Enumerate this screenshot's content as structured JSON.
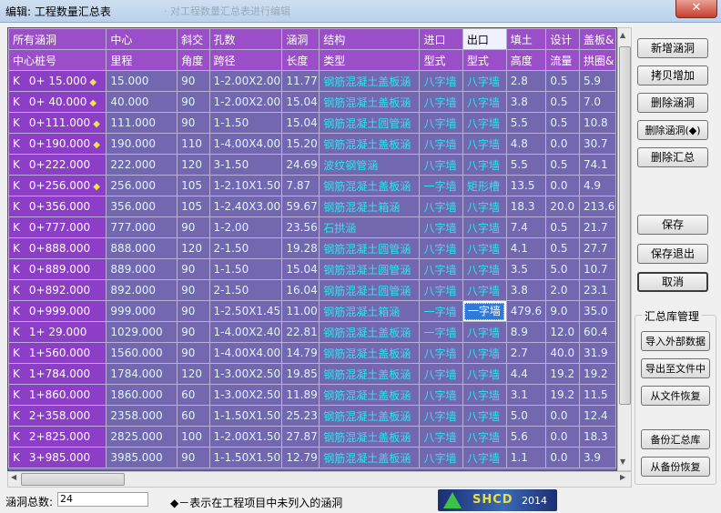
{
  "window": {
    "title": "编辑: 工程数量汇总表",
    "faded_title": "· 对工程数量汇总表进行编辑",
    "close_label": "✕"
  },
  "table": {
    "header1": [
      "所有涵洞",
      "中心",
      "斜交",
      "孔数",
      "涵洞",
      "结构",
      "进口",
      "出口",
      "填土",
      "设计",
      "盖板&"
    ],
    "header2": [
      "中心桩号",
      "里程",
      "角度",
      "跨径",
      "长度",
      "类型",
      "型式",
      "型式",
      "高度",
      "流量",
      "拱圈&"
    ],
    "rows": [
      {
        "k": "K",
        "sta": "0+ 15.000",
        "mark": true,
        "m": "15.000",
        "ang": "90",
        "span": "1-2.00X2.00",
        "len": "11.77",
        "type": "钢筋混凝土盖板涵",
        "in": "八字墙",
        "out": "八字墙",
        "h": "2.8",
        "q": "0.5",
        "last": "5.9"
      },
      {
        "k": "K",
        "sta": "0+ 40.000",
        "mark": true,
        "m": "40.000",
        "ang": "90",
        "span": "1-2.00X2.00",
        "len": "15.04",
        "type": "钢筋混凝土盖板涵",
        "in": "八字墙",
        "out": "八字墙",
        "h": "3.8",
        "q": "0.5",
        "last": "7.0"
      },
      {
        "k": "K",
        "sta": "0+111.000",
        "mark": true,
        "m": "111.000",
        "ang": "90",
        "span": "1-1.50",
        "len": "15.04",
        "type": "钢筋混凝土圆管涵",
        "in": "八字墙",
        "out": "八字墙",
        "h": "5.5",
        "q": "0.5",
        "last": "10.8"
      },
      {
        "k": "K",
        "sta": "0+190.000",
        "mark": true,
        "m": "190.000",
        "ang": "110",
        "span": "1-4.00X4.00",
        "len": "15.20",
        "type": "钢筋混凝土盖板涵",
        "in": "八字墙",
        "out": "八字墙",
        "h": "4.8",
        "q": "0.0",
        "last": "30.7"
      },
      {
        "k": "K",
        "sta": "0+222.000",
        "mark": false,
        "m": "222.000",
        "ang": "120",
        "span": "3-1.50",
        "len": "24.69",
        "type": "波纹钢管涵",
        "in": "八字墙",
        "out": "八字墙",
        "h": "5.5",
        "q": "0.5",
        "last": "74.1"
      },
      {
        "k": "K",
        "sta": "0+256.000",
        "mark": true,
        "m": "256.000",
        "ang": "105",
        "span": "1-2.10X1.50",
        "len": "7.87",
        "type": "钢筋混凝土盖板涵",
        "in": "一字墙",
        "out": "矩形槽",
        "h": "13.5",
        "q": "0.0",
        "last": "4.9"
      },
      {
        "k": "K",
        "sta": "0+356.000",
        "mark": false,
        "m": "356.000",
        "ang": "105",
        "span": "1-2.40X3.00",
        "len": "59.67",
        "type": "钢筋混凝土箱涵",
        "in": "八字墙",
        "out": "八字墙",
        "h": "18.3",
        "q": "20.0",
        "last": "213.6"
      },
      {
        "k": "K",
        "sta": "0+777.000",
        "mark": false,
        "m": "777.000",
        "ang": "90",
        "span": "1-2.00",
        "len": "23.56",
        "type": "石拱涵",
        "in": "八字墙",
        "out": "八字墙",
        "h": "7.4",
        "q": "0.5",
        "last": "21.7"
      },
      {
        "k": "K",
        "sta": "0+888.000",
        "mark": false,
        "m": "888.000",
        "ang": "120",
        "span": "2-1.50",
        "len": "19.28",
        "type": "钢筋混凝土圆管涵",
        "in": "八字墙",
        "out": "八字墙",
        "h": "4.1",
        "q": "0.5",
        "last": "27.7"
      },
      {
        "k": "K",
        "sta": "0+889.000",
        "mark": false,
        "m": "889.000",
        "ang": "90",
        "span": "1-1.50",
        "len": "15.04",
        "type": "钢筋混凝土圆管涵",
        "in": "八字墙",
        "out": "八字墙",
        "h": "3.5",
        "q": "5.0",
        "last": "10.7"
      },
      {
        "k": "K",
        "sta": "0+892.000",
        "mark": false,
        "m": "892.000",
        "ang": "90",
        "span": "2-1.50",
        "len": "16.04",
        "type": "钢筋混凝土圆管涵",
        "in": "八字墙",
        "out": "八字墙",
        "h": "3.8",
        "q": "2.0",
        "last": "23.1"
      },
      {
        "k": "K",
        "sta": "0+999.000",
        "mark": false,
        "m": "999.000",
        "ang": "90",
        "span": "1-2.50X1.45",
        "len": "11.00",
        "type": "钢筋混凝土箱涵",
        "in": "一字墙",
        "out": "一字墙",
        "h": "479.6",
        "q": "9.0",
        "last": "35.0",
        "selected": true
      },
      {
        "k": "K",
        "sta": "1+ 29.000",
        "mark": false,
        "m": "1029.000",
        "ang": "90",
        "span": "1-4.00X2.40",
        "len": "22.81",
        "type": "钢筋混凝土盖板涵",
        "in": "一字墙",
        "out": "八字墙",
        "h": "8.9",
        "q": "12.0",
        "last": "60.4"
      },
      {
        "k": "K",
        "sta": "1+560.000",
        "mark": false,
        "m": "1560.000",
        "ang": "90",
        "span": "1-4.00X4.00",
        "len": "14.79",
        "type": "钢筋混凝土盖板涵",
        "in": "八字墙",
        "out": "八字墙",
        "h": "2.7",
        "q": "40.0",
        "last": "31.9"
      },
      {
        "k": "K",
        "sta": "1+784.000",
        "mark": false,
        "m": "1784.000",
        "ang": "120",
        "span": "1-3.00X2.50",
        "len": "19.85",
        "type": "钢筋混凝土盖板涵",
        "in": "八字墙",
        "out": "八字墙",
        "h": "4.4",
        "q": "19.2",
        "last": "19.2"
      },
      {
        "k": "K",
        "sta": "1+860.000",
        "mark": false,
        "m": "1860.000",
        "ang": "60",
        "span": "1-3.00X2.50",
        "len": "11.89",
        "type": "钢筋混凝土盖板涵",
        "in": "八字墙",
        "out": "八字墙",
        "h": "3.1",
        "q": "19.2",
        "last": "11.5"
      },
      {
        "k": "K",
        "sta": "2+358.000",
        "mark": false,
        "m": "2358.000",
        "ang": "60",
        "span": "1-1.50X1.50",
        "len": "25.23",
        "type": "钢筋混凝土盖板涵",
        "in": "八字墙",
        "out": "八字墙",
        "h": "5.0",
        "q": "0.0",
        "last": "12.4"
      },
      {
        "k": "K",
        "sta": "2+825.000",
        "mark": false,
        "m": "2825.000",
        "ang": "100",
        "span": "1-2.00X1.50",
        "len": "27.87",
        "type": "钢筋混凝土盖板涵",
        "in": "八字墙",
        "out": "八字墙",
        "h": "5.6",
        "q": "0.0",
        "last": "18.3"
      },
      {
        "k": "K",
        "sta": "3+985.000",
        "mark": false,
        "m": "3985.000",
        "ang": "90",
        "span": "1-1.50X1.50",
        "len": "12.79",
        "type": "钢筋混凝土盖板涵",
        "in": "八字墙",
        "out": "八字墙",
        "h": "1.1",
        "q": "0.0",
        "last": "3.9"
      }
    ],
    "diamond_glyph": "◆"
  },
  "buttons": {
    "add": "新增涵洞",
    "copy_add": "拷贝增加",
    "delete": "删除涵洞",
    "delete_marked": "删除涵洞(◆)",
    "delete_summary": "删除汇总",
    "save": "保存",
    "save_exit": "保存退出",
    "cancel": "取消"
  },
  "library": {
    "group_label": "汇总库管理",
    "import": "导入外部数据",
    "export": "导出至文件中",
    "restore_file": "从文件恢复",
    "backup": "备份汇总库",
    "restore_backup": "从备份恢复"
  },
  "status": {
    "count_label": "涵洞总数:",
    "count_value": "24",
    "note": "◆－表示在工程项目中未列入的涵洞",
    "logo_text": "SHCD",
    "logo_year": "2014"
  },
  "colors": {
    "grid_bg": "#7367b0",
    "header_bg": "#9a4fc8",
    "value_cyan": "#29e6ef",
    "diamond": "#f2e34e"
  }
}
